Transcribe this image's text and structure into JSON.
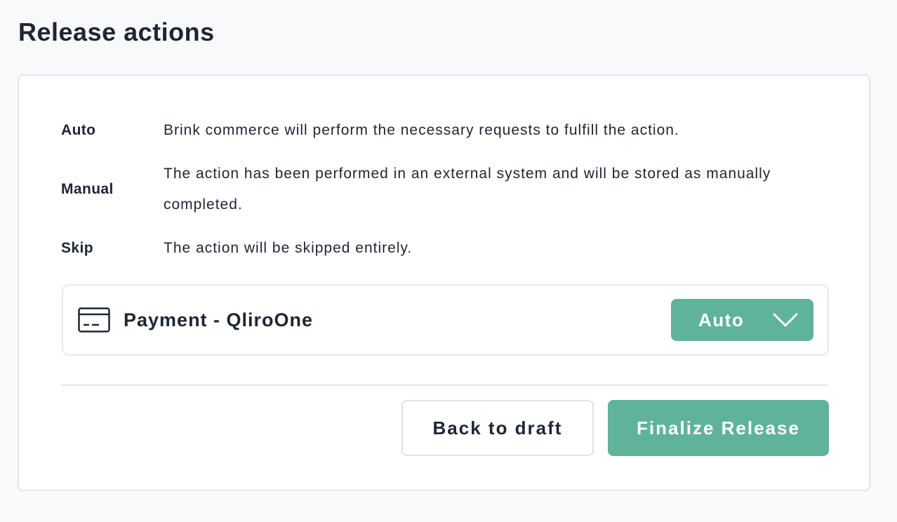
{
  "page": {
    "title": "Release actions"
  },
  "legend": [
    {
      "term": "Auto",
      "description": "Brink commerce will perform the necessary requests to fulfill the action."
    },
    {
      "term": "Manual",
      "description": "The action has been performed in an external system and will be stored as manually completed."
    },
    {
      "term": "Skip",
      "description": "The action will be skipped entirely."
    }
  ],
  "actions": [
    {
      "icon": "credit-card-icon",
      "label": "Payment - QliroOne",
      "mode": "Auto",
      "mode_icon": "chevron-down-icon"
    }
  ],
  "buttons": {
    "back": "Back to draft",
    "finalize": "Finalize Release"
  },
  "colors": {
    "accent": "#5fb39a",
    "text": "#1e2533",
    "background": "#f8f9fb",
    "border": "#e4e6ea"
  }
}
